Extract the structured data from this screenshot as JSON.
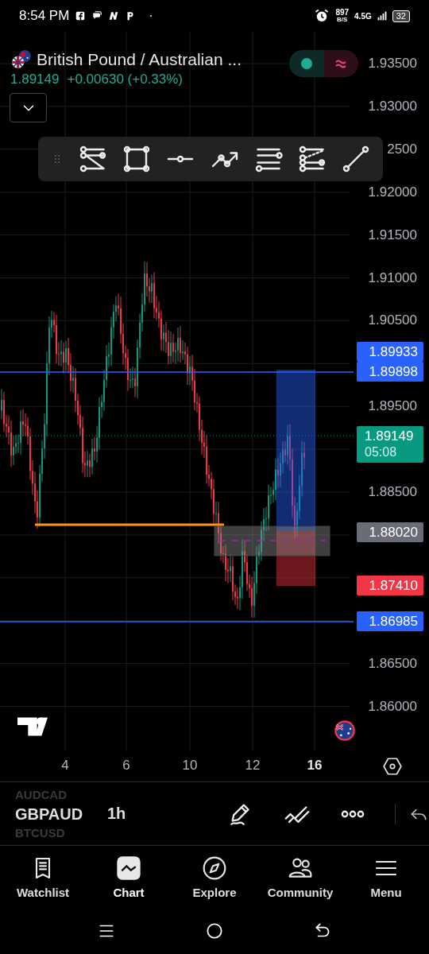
{
  "status_bar": {
    "time": "8:54 PM",
    "net_speed": "897",
    "net_unit": "B/S",
    "network": "4.5G",
    "battery": "32"
  },
  "header": {
    "title": "British Pound / Australian ...",
    "price": "1.89149",
    "change": "+0.00630 (+0.33%)"
  },
  "price_axis": {
    "labels": [
      {
        "text": "1.93500"
      },
      {
        "text": "1.93000"
      },
      {
        "text": "2500"
      },
      {
        "text": "1.92000"
      },
      {
        "text": "1.91500"
      },
      {
        "text": "1.91000"
      },
      {
        "text": "1.90500"
      },
      {
        "text": "1.89500"
      },
      {
        "text": "1.88500"
      },
      {
        "text": "1.86500"
      },
      {
        "text": "1.86000"
      }
    ]
  },
  "price_tags": [
    {
      "text": "1.89933",
      "color": "#2962ff"
    },
    {
      "text": "1.89898",
      "color": "#2962ff"
    },
    {
      "text": "1.89149",
      "countdown": "05:08",
      "color": "#089981"
    },
    {
      "text": "1.88020",
      "color": "#6a6d78"
    },
    {
      "text": "1.87410",
      "color": "#f23645"
    },
    {
      "text": "1.86985",
      "color": "#2962ff"
    }
  ],
  "time_axis": [
    {
      "text": "4",
      "highlighted": false
    },
    {
      "text": "6",
      "highlighted": false
    },
    {
      "text": "10",
      "highlighted": false
    },
    {
      "text": "12",
      "highlighted": false
    },
    {
      "text": "16",
      "highlighted": true
    }
  ],
  "symbol_bar": {
    "symbols": [
      {
        "text": "AUDCAD",
        "selected": false
      },
      {
        "text": "GBPAUD",
        "selected": true
      },
      {
        "text": "BTCUSD",
        "selected": false
      }
    ],
    "interval": "1h"
  },
  "nav": [
    {
      "label": "Watchlist",
      "selected": false
    },
    {
      "label": "Chart",
      "selected": true
    },
    {
      "label": "Explore",
      "selected": false
    },
    {
      "label": "Community",
      "selected": false
    },
    {
      "label": "Menu",
      "selected": false
    }
  ]
}
